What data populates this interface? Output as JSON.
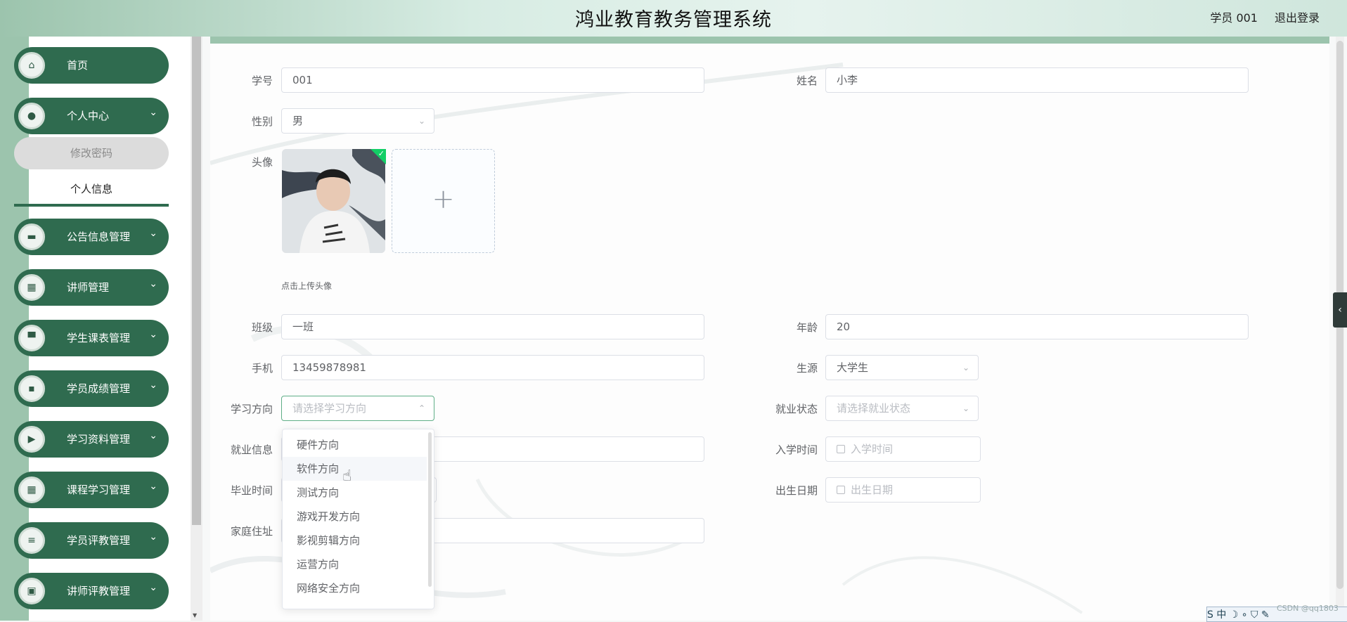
{
  "header": {
    "title": "鸿业教育教务管理系统",
    "user": "学员  001",
    "logout": "退出登录"
  },
  "sidebar": {
    "items": [
      {
        "label": "首页",
        "icon": "home-icon",
        "glyph": "⌂"
      },
      {
        "label": "个人中心",
        "icon": "user-icon",
        "glyph": "●"
      },
      {
        "label": "公告信息管理",
        "icon": "notice-icon",
        "glyph": "▬"
      },
      {
        "label": "讲师管理",
        "icon": "grid-icon",
        "glyph": "▦"
      },
      {
        "label": "学生课表管理",
        "icon": "briefcase-icon",
        "glyph": "▀"
      },
      {
        "label": "学员成绩管理",
        "icon": "chat-icon",
        "glyph": "▪"
      },
      {
        "label": "学习资料管理",
        "icon": "video-icon",
        "glyph": "▶"
      },
      {
        "label": "课程学习管理",
        "icon": "grid-icon",
        "glyph": "▦"
      },
      {
        "label": "学员评教管理",
        "icon": "list-icon",
        "glyph": "≡"
      },
      {
        "label": "讲师评教管理",
        "icon": "clipboard-icon",
        "glyph": "▣"
      }
    ],
    "sub_items": [
      {
        "label": "修改密码"
      },
      {
        "label": "个人信息"
      }
    ],
    "chevron": "⌄"
  },
  "form": {
    "student_id": {
      "label": "学号",
      "value": "001"
    },
    "name": {
      "label": "姓名",
      "value": "小李"
    },
    "gender": {
      "label": "性别",
      "value": "男"
    },
    "avatar": {
      "label": "头像",
      "hint": "点击上传头像",
      "plus": "+"
    },
    "class": {
      "label": "班级",
      "value": "一班"
    },
    "age": {
      "label": "年龄",
      "value": "20"
    },
    "phone": {
      "label": "手机",
      "value": "13459878981"
    },
    "source": {
      "label": "生源",
      "value": "大学生"
    },
    "direction": {
      "label": "学习方向",
      "placeholder": "请选择学习方向"
    },
    "employment_status": {
      "label": "就业状态",
      "placeholder": "请选择就业状态"
    },
    "employment_info": {
      "label": "就业信息"
    },
    "enroll_date": {
      "label": "入学时间",
      "placeholder": "入学时间"
    },
    "graduation": {
      "label": "毕业时间"
    },
    "birth_date": {
      "label": "出生日期",
      "placeholder": "出生日期"
    },
    "address": {
      "label": "家庭住址"
    }
  },
  "dropdown": {
    "options": [
      {
        "label": "硬件方向"
      },
      {
        "label": "软件方向"
      },
      {
        "label": "测试方向"
      },
      {
        "label": "游戏开发方向"
      },
      {
        "label": "影视剪辑方向"
      },
      {
        "label": "运营方向"
      },
      {
        "label": "网络安全方向"
      }
    ]
  },
  "taskbar": {
    "ime": "S 中 ☽ ∘ ⛉ ✎",
    "watermark": "CSDN @qq1803"
  }
}
